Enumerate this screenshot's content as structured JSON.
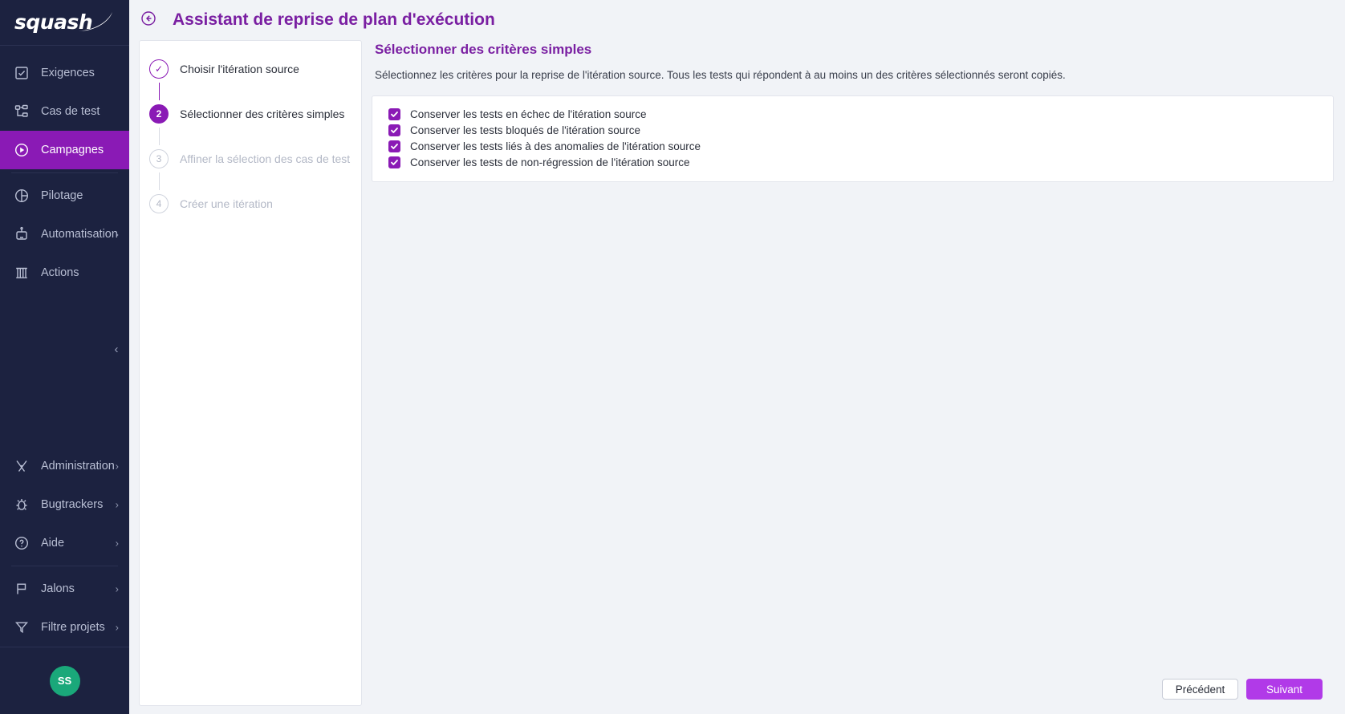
{
  "brand": {
    "logo_text": "squash",
    "accent_purple": "#7a1fa2",
    "active_purple": "#8a1ab5",
    "primary_button": "#b13ae8",
    "avatar_green": "#1aa87a",
    "sidebar_bg": "#1c2240"
  },
  "sidebar": {
    "items": [
      {
        "label": "Exigences",
        "icon": "requirements-icon",
        "chevron": ""
      },
      {
        "label": "Cas de test",
        "icon": "test-case-icon",
        "chevron": ""
      },
      {
        "label": "Campagnes",
        "icon": "campaign-play-icon",
        "chevron": "",
        "active": true
      },
      {
        "label": "Pilotage",
        "icon": "pie-chart-icon",
        "chevron": ""
      },
      {
        "label": "Automatisation",
        "icon": "robot-icon",
        "chevron": "›"
      },
      {
        "label": "Actions",
        "icon": "actions-icon",
        "chevron": ""
      },
      {
        "label": "Administration",
        "icon": "tools-icon",
        "chevron": "›"
      },
      {
        "label": "Bugtrackers",
        "icon": "bug-icon",
        "chevron": "›"
      },
      {
        "label": "Aide",
        "icon": "help-circle-icon",
        "chevron": "›"
      },
      {
        "label": "Jalons",
        "icon": "flag-icon",
        "chevron": "›"
      },
      {
        "label": "Filtre projets",
        "icon": "funnel-icon",
        "chevron": "›"
      }
    ],
    "collapse_icon": "‹",
    "avatar_initials": "SS"
  },
  "header": {
    "back_icon": "back-circle-icon",
    "title": "Assistant de reprise de plan d'exécution"
  },
  "stepper": {
    "steps": [
      {
        "marker": "✓",
        "label": "Choisir l'itération source",
        "state": "done"
      },
      {
        "marker": "2",
        "label": "Sélectionner des critères simples",
        "state": "current"
      },
      {
        "marker": "3",
        "label": "Affiner la sélection des cas de test",
        "state": "todo"
      },
      {
        "marker": "4",
        "label": "Créer une itération",
        "state": "todo"
      }
    ]
  },
  "content": {
    "title": "Sélectionner des critères simples",
    "description": "Sélectionnez les critères pour la reprise de l'itération source. Tous les tests qui répondent à au moins un des critères sélectionnés seront copiés.",
    "criteria": [
      {
        "label": "Conserver les tests en échec de l'itération source",
        "checked": true
      },
      {
        "label": "Conserver les tests bloqués de l'itération source",
        "checked": true
      },
      {
        "label": "Conserver les tests liés à des anomalies de l'itération source",
        "checked": true
      },
      {
        "label": "Conserver les tests de non-régression de l'itération source",
        "checked": true
      }
    ]
  },
  "footer": {
    "previous_label": "Précédent",
    "next_label": "Suivant"
  }
}
